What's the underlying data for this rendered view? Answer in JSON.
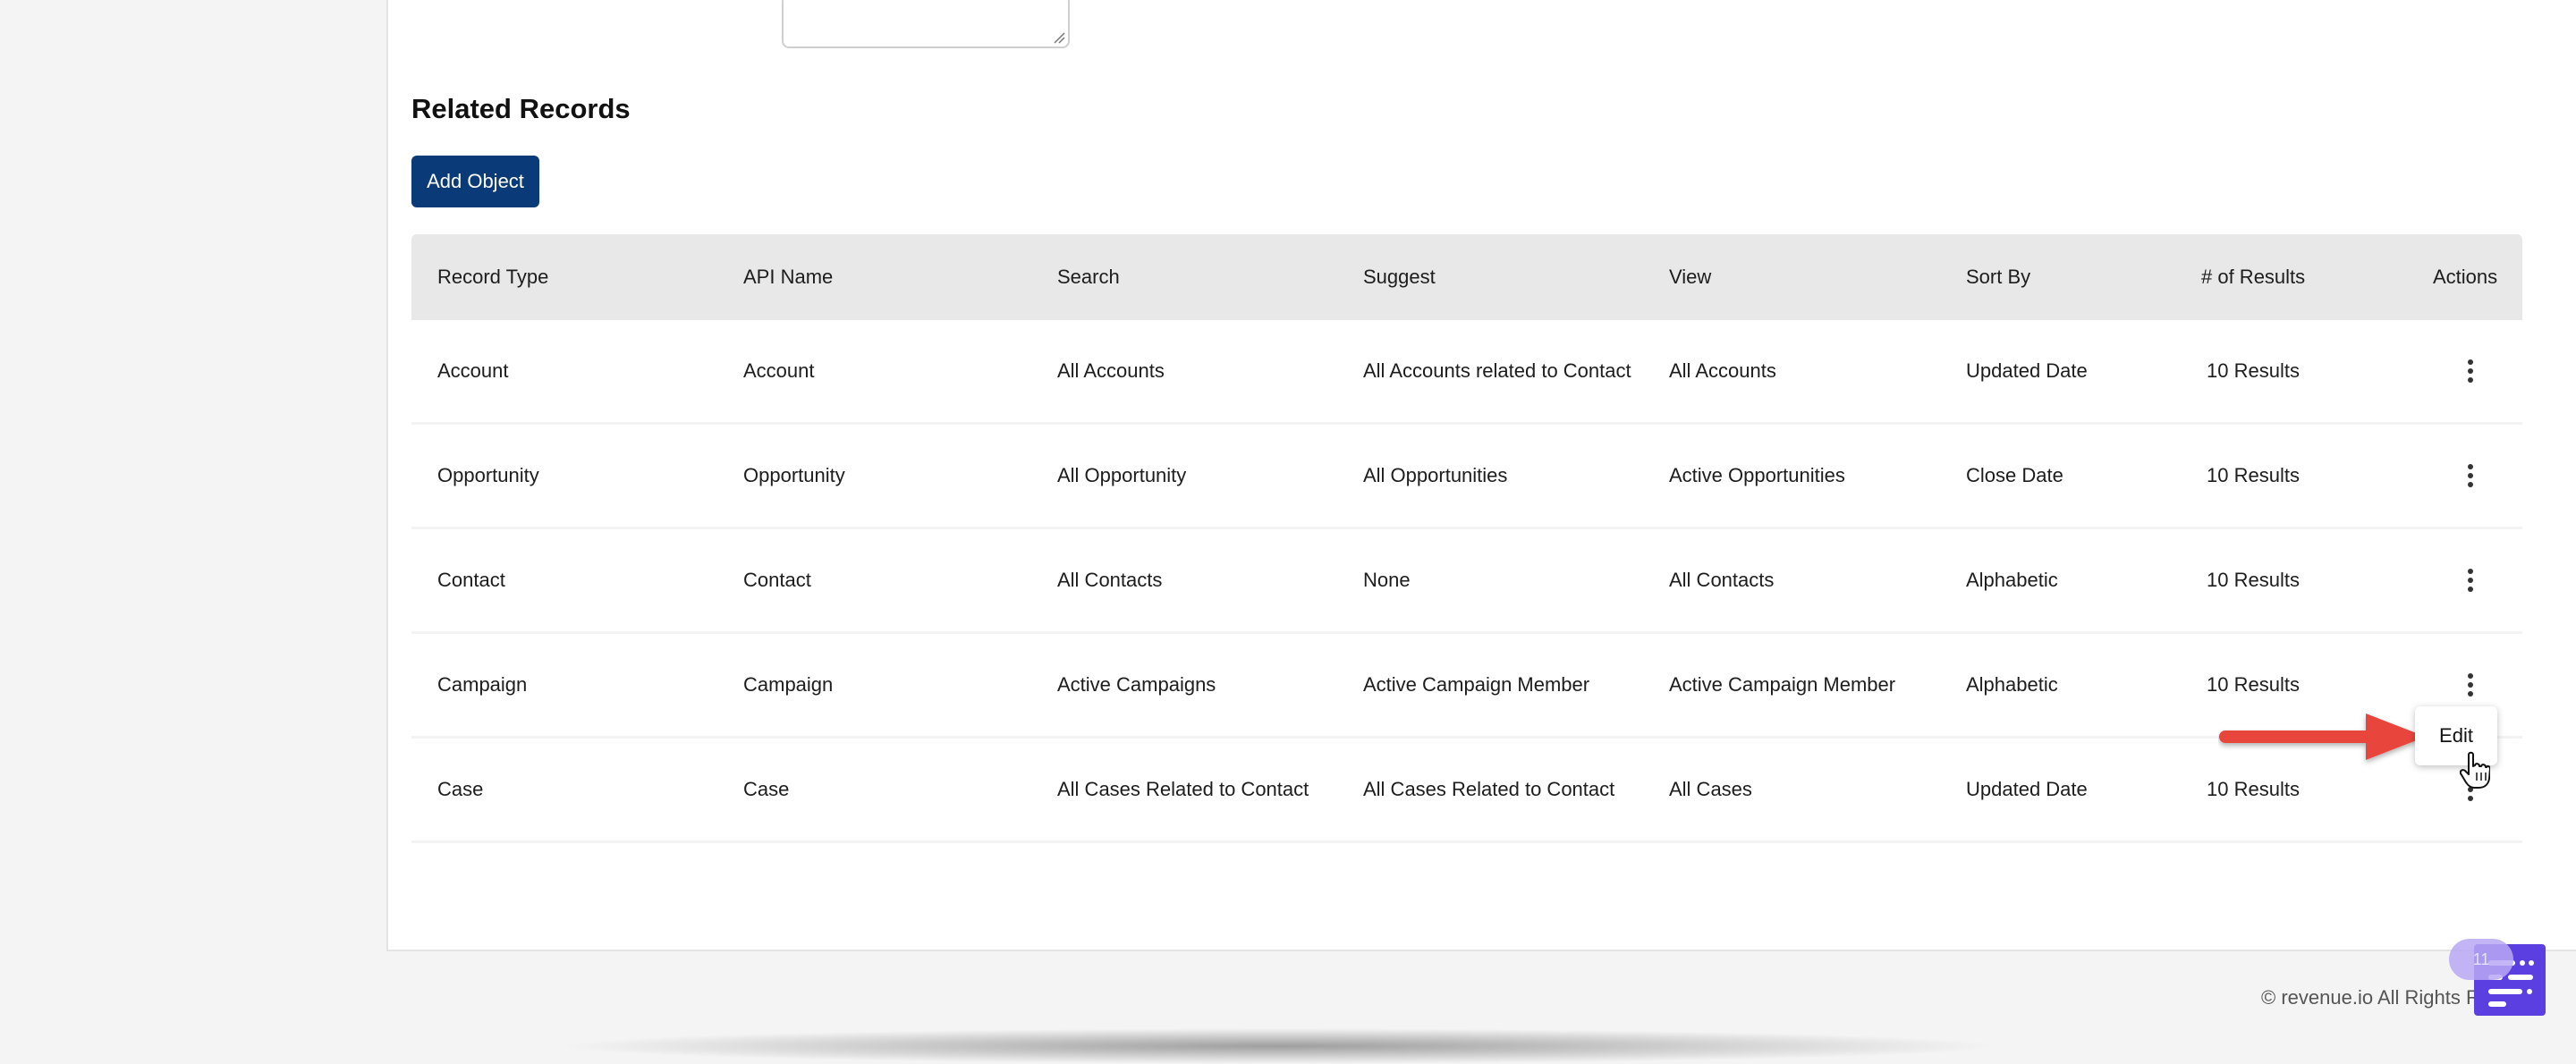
{
  "section_title": "Related Records",
  "add_object_label": "Add Object",
  "table": {
    "headers": [
      "Record Type",
      "API Name",
      "Search",
      "Suggest",
      "View",
      "Sort By",
      "# of Results",
      "Actions"
    ],
    "rows": [
      [
        "Account",
        "Account",
        "All Accounts",
        "All Accounts related to Contact",
        "All Accounts",
        "Updated Date",
        "10 Results"
      ],
      [
        "Opportunity",
        "Opportunity",
        "All Opportunity",
        "All Opportunities",
        "Active Opportunities",
        "Close Date",
        "10 Results"
      ],
      [
        "Contact",
        "Contact",
        "All Contacts",
        "None",
        "All Contacts",
        "Alphabetic",
        "10 Results"
      ],
      [
        "Campaign",
        "Campaign",
        "Active Campaigns",
        "Active Campaign Member",
        "Active Campaign Member",
        "Alphabetic",
        "10 Results"
      ],
      [
        "Case",
        "Case",
        "All Cases Related to Contact",
        "All Cases Related to Contact",
        "All Cases",
        "Updated Date",
        "10 Results"
      ]
    ]
  },
  "context_menu": {
    "edit_label": "Edit"
  },
  "footer_text": "© revenue.io All Rights R",
  "chat_badge_count": "11",
  "colors": {
    "primary_button": "#0b3a78",
    "annotation_arrow": "#e8453c",
    "chat_widget": "#5b3fe0"
  },
  "icons": [
    "kebab-menu-icon",
    "annotation-arrow",
    "hand-cursor-icon",
    "chat-widget-icon",
    "resize-grip-icon"
  ]
}
